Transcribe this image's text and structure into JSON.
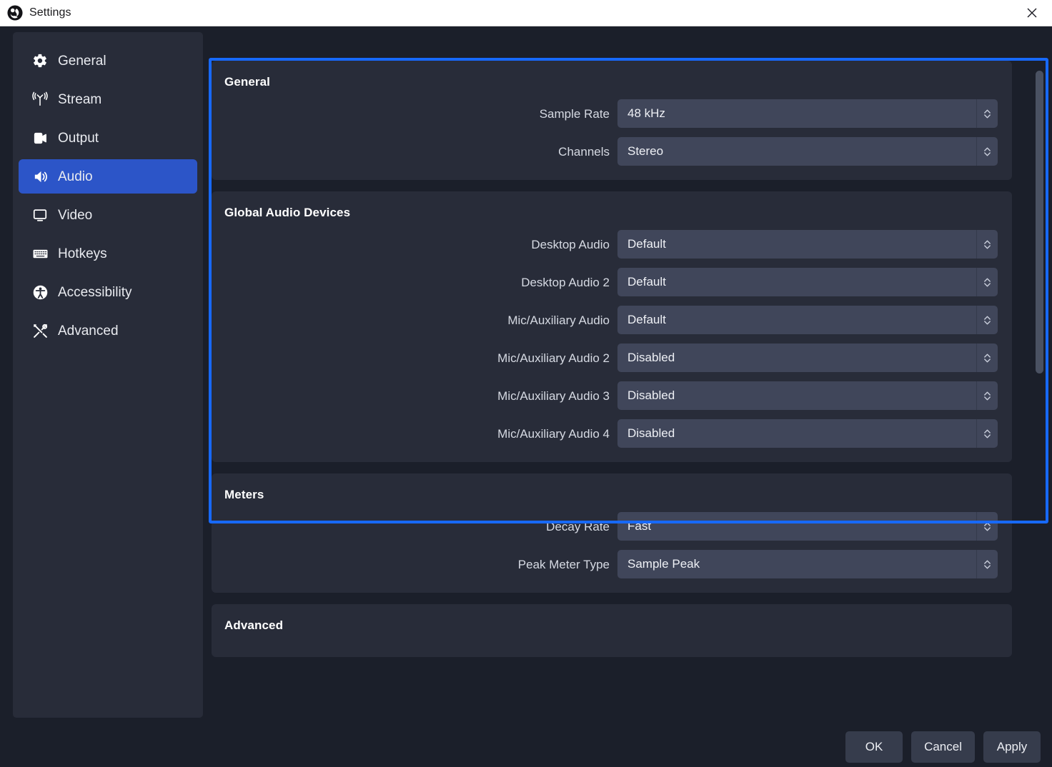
{
  "window": {
    "title": "Settings",
    "logo_icon": "obs-logo-icon",
    "close_icon": "close-icon"
  },
  "colors": {
    "accent_blue": "#2c55c8",
    "focus_ring_blue": "#1769ff",
    "panel_bg": "#282c39",
    "window_bg": "#1b1f2a",
    "field_bg": "#40465a",
    "titlebar_bg": "#ffffff"
  },
  "sidebar": {
    "items": [
      {
        "label": "General",
        "icon": "gear-icon",
        "active": false
      },
      {
        "label": "Stream",
        "icon": "broadcast-icon",
        "active": false
      },
      {
        "label": "Output",
        "icon": "video-camera-icon",
        "active": false
      },
      {
        "label": "Audio",
        "icon": "speaker-icon",
        "active": true
      },
      {
        "label": "Video",
        "icon": "monitor-icon",
        "active": false
      },
      {
        "label": "Hotkeys",
        "icon": "keyboard-icon",
        "active": false
      },
      {
        "label": "Accessibility",
        "icon": "accessibility-icon",
        "active": false
      },
      {
        "label": "Advanced",
        "icon": "tools-icon",
        "active": false
      }
    ]
  },
  "content": {
    "sections": [
      {
        "title": "General",
        "fields": [
          {
            "label": "Sample Rate",
            "value": "48 kHz"
          },
          {
            "label": "Channels",
            "value": "Stereo"
          }
        ]
      },
      {
        "title": "Global Audio Devices",
        "fields": [
          {
            "label": "Desktop Audio",
            "value": "Default"
          },
          {
            "label": "Desktop Audio 2",
            "value": "Default"
          },
          {
            "label": "Mic/Auxiliary Audio",
            "value": "Default"
          },
          {
            "label": "Mic/Auxiliary Audio 2",
            "value": "Disabled"
          },
          {
            "label": "Mic/Auxiliary Audio 3",
            "value": "Disabled"
          },
          {
            "label": "Mic/Auxiliary Audio 4",
            "value": "Disabled"
          }
        ]
      },
      {
        "title": "Meters",
        "fields": [
          {
            "label": "Decay Rate",
            "value": "Fast"
          },
          {
            "label": "Peak Meter Type",
            "value": "Sample Peak"
          }
        ]
      },
      {
        "title": "Advanced",
        "fields": []
      }
    ]
  },
  "footer": {
    "buttons": [
      {
        "label": "OK"
      },
      {
        "label": "Cancel"
      },
      {
        "label": "Apply"
      }
    ]
  }
}
